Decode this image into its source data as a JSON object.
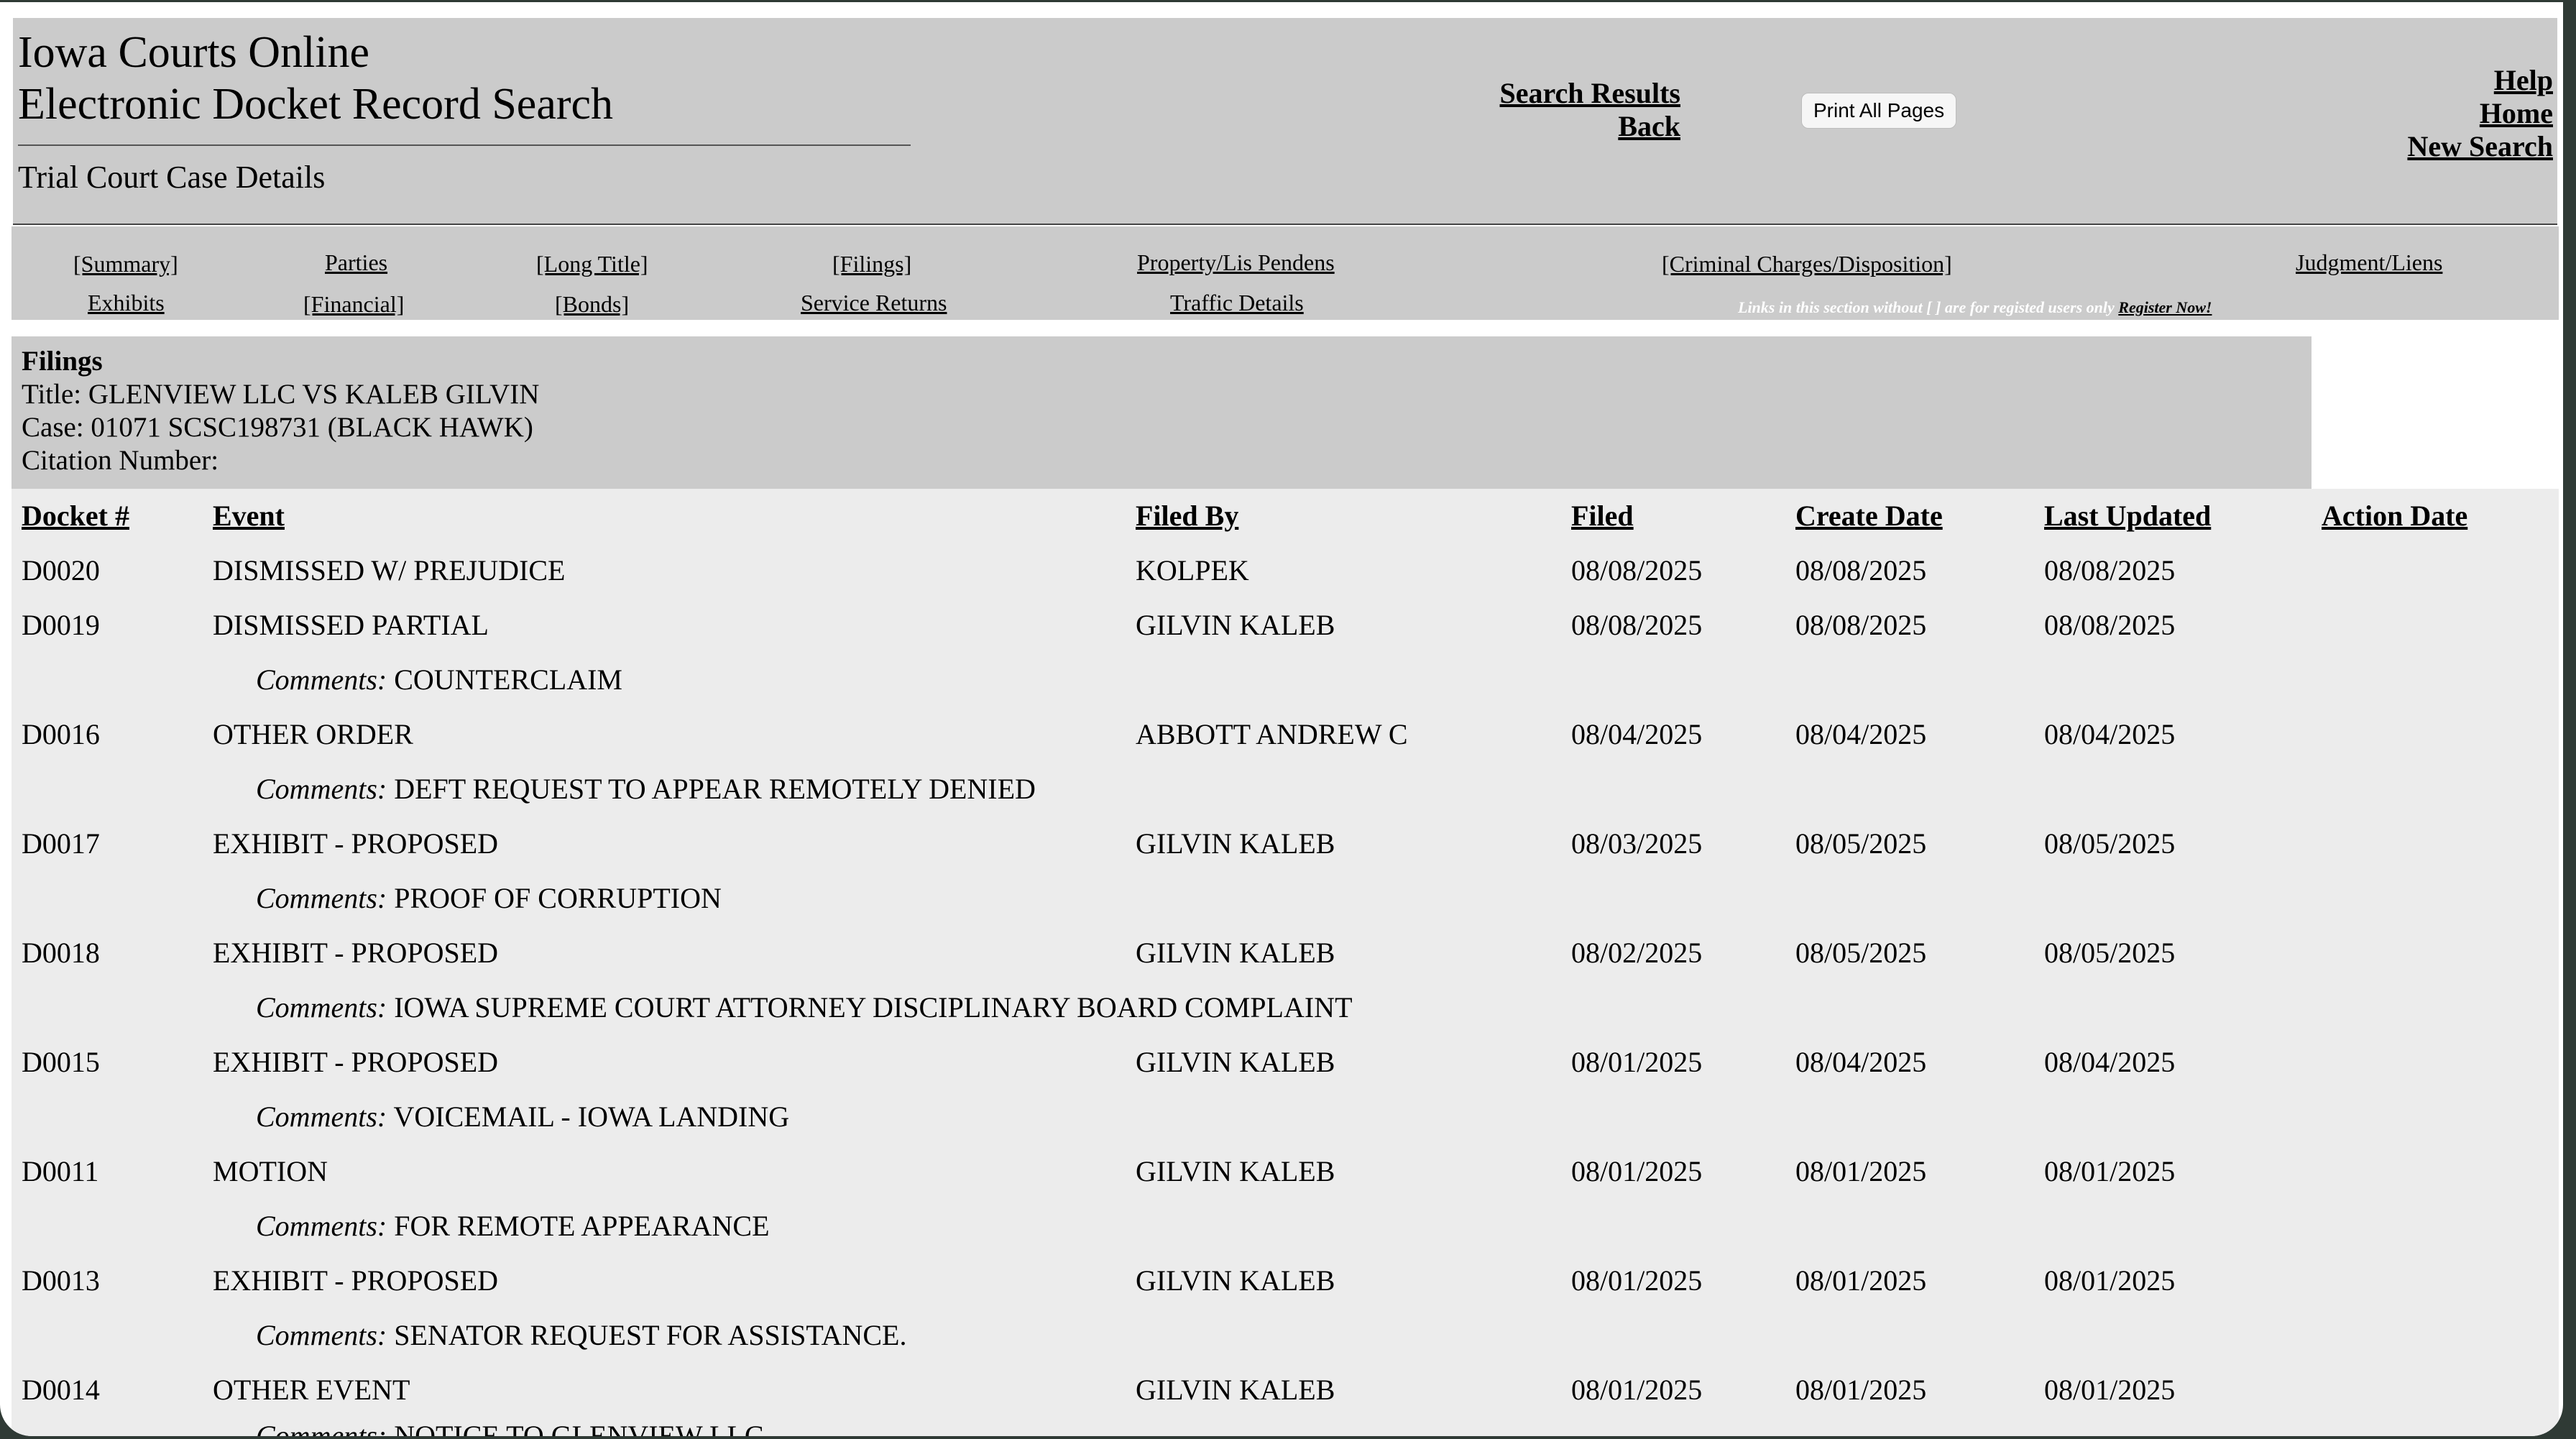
{
  "header": {
    "site_title_line1": "Iowa Courts Online",
    "site_title_line2": "Electronic Docket Record Search",
    "sub_title": "Trial Court Case Details",
    "search_results": "Search Results",
    "back": "Back",
    "print_all": "Print All Pages",
    "help": "Help",
    "home": "Home",
    "new_search": "New Search"
  },
  "nav": {
    "summary": "[Summary]",
    "parties": "Parties",
    "long_title": "[Long Title]",
    "filings": "[Filings]",
    "property": "Property/Lis Pendens",
    "criminal": "[Criminal Charges/Disposition]",
    "judgment": "Judgment/Liens",
    "exhibits": "Exhibits",
    "financial": "[Financial]",
    "bonds": "[Bonds]",
    "service_returns": "Service Returns",
    "traffic": "Traffic Details",
    "note": "Links in this section without [ ] are for registed users only",
    "register": "Register Now!"
  },
  "info": {
    "heading": "Filings",
    "title": "Title: GLENVIEW LLC VS KALEB GILVIN",
    "case": "Case: 01071 SCSC198731 (BLACK HAWK)",
    "citation": "Citation Number:"
  },
  "table": {
    "headers": {
      "docket": "Docket #",
      "event": "Event",
      "filed_by": "Filed By",
      "filed": "Filed",
      "create_date": "Create Date",
      "last_updated": "Last Updated",
      "action_date": "Action Date"
    },
    "comment_label": "Comments:",
    "rows": [
      {
        "docket": "D0020",
        "event": "DISMISSED W/ PREJUDICE",
        "filed_by": "KOLPEK",
        "filed": "08/08/2025",
        "create": "08/08/2025",
        "updated": "08/08/2025",
        "comment": ""
      },
      {
        "docket": "D0019",
        "event": "DISMISSED PARTIAL",
        "filed_by": "GILVIN KALEB",
        "filed": "08/08/2025",
        "create": "08/08/2025",
        "updated": "08/08/2025",
        "comment": "COUNTERCLAIM"
      },
      {
        "docket": "D0016",
        "event": "OTHER ORDER",
        "filed_by": "ABBOTT ANDREW C",
        "filed": "08/04/2025",
        "create": "08/04/2025",
        "updated": "08/04/2025",
        "comment": "DEFT REQUEST TO APPEAR REMOTELY DENIED"
      },
      {
        "docket": "D0017",
        "event": "EXHIBIT - PROPOSED",
        "filed_by": "GILVIN KALEB",
        "filed": "08/03/2025",
        "create": "08/05/2025",
        "updated": "08/05/2025",
        "comment": "PROOF OF CORRUPTION"
      },
      {
        "docket": "D0018",
        "event": "EXHIBIT - PROPOSED",
        "filed_by": "GILVIN KALEB",
        "filed": "08/02/2025",
        "create": "08/05/2025",
        "updated": "08/05/2025",
        "comment": "IOWA SUPREME COURT ATTORNEY DISCIPLINARY BOARD COMPLAINT"
      },
      {
        "docket": "D0015",
        "event": "EXHIBIT - PROPOSED",
        "filed_by": "GILVIN KALEB",
        "filed": "08/01/2025",
        "create": "08/04/2025",
        "updated": "08/04/2025",
        "comment": "VOICEMAIL - IOWA LANDING"
      },
      {
        "docket": "D0011",
        "event": "MOTION",
        "filed_by": "GILVIN KALEB",
        "filed": "08/01/2025",
        "create": "08/01/2025",
        "updated": "08/01/2025",
        "comment": "FOR REMOTE APPEARANCE"
      },
      {
        "docket": "D0013",
        "event": "EXHIBIT - PROPOSED",
        "filed_by": "GILVIN KALEB",
        "filed": "08/01/2025",
        "create": "08/01/2025",
        "updated": "08/01/2025",
        "comment": "SENATOR REQUEST FOR ASSISTANCE."
      },
      {
        "docket": "D0014",
        "event": "OTHER EVENT",
        "filed_by": "GILVIN KALEB",
        "filed": "08/01/2025",
        "create": "08/01/2025",
        "updated": "08/01/2025",
        "comment": "NOTICE TO GLENVIEW LLC"
      }
    ]
  }
}
